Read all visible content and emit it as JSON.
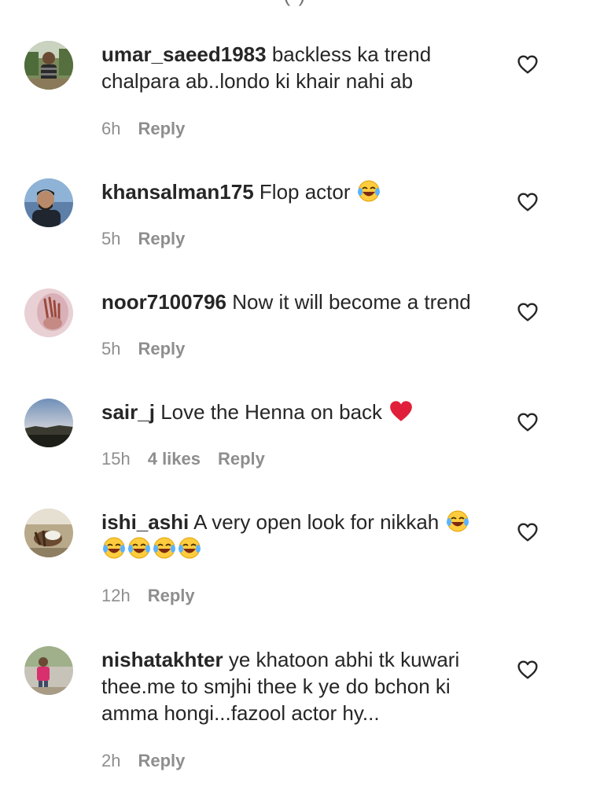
{
  "comments": [
    {
      "username": "umar_saeed1983",
      "text": "backless ka trend chalpara ab..londo ki khair nahi ab",
      "time": "6h",
      "likes": "",
      "reply": "Reply"
    },
    {
      "username": "khansalman175",
      "text": "Flop actor",
      "time": "5h",
      "likes": "",
      "reply": "Reply"
    },
    {
      "username": "noor7100796",
      "text": "Now it will become a trend",
      "time": "5h",
      "likes": "",
      "reply": "Reply"
    },
    {
      "username": "sair_j",
      "text": "Love the Henna on back",
      "time": "15h",
      "likes": "4 likes",
      "reply": "Reply"
    },
    {
      "username": "ishi_ashi",
      "text": "A very open look for nikkah",
      "time": "12h",
      "likes": "",
      "reply": "Reply"
    },
    {
      "username": "nishatakhter",
      "text": "ye khatoon abhi tk kuwari thee.me to smjhi thee k ye do bchon ki amma hongi...fazool actor hy...",
      "time": "2h",
      "likes": "",
      "reply": "Reply"
    }
  ],
  "icons": {
    "like": "heart-outline-icon",
    "laughing": "face-with-tears-of-joy-emoji",
    "red_heart": "red-heart-emoji"
  },
  "colors": {
    "text": "#262626",
    "meta": "#8e8e8e",
    "heart_emoji": "#e0203a",
    "emoji_face": "#ffcc3e"
  }
}
